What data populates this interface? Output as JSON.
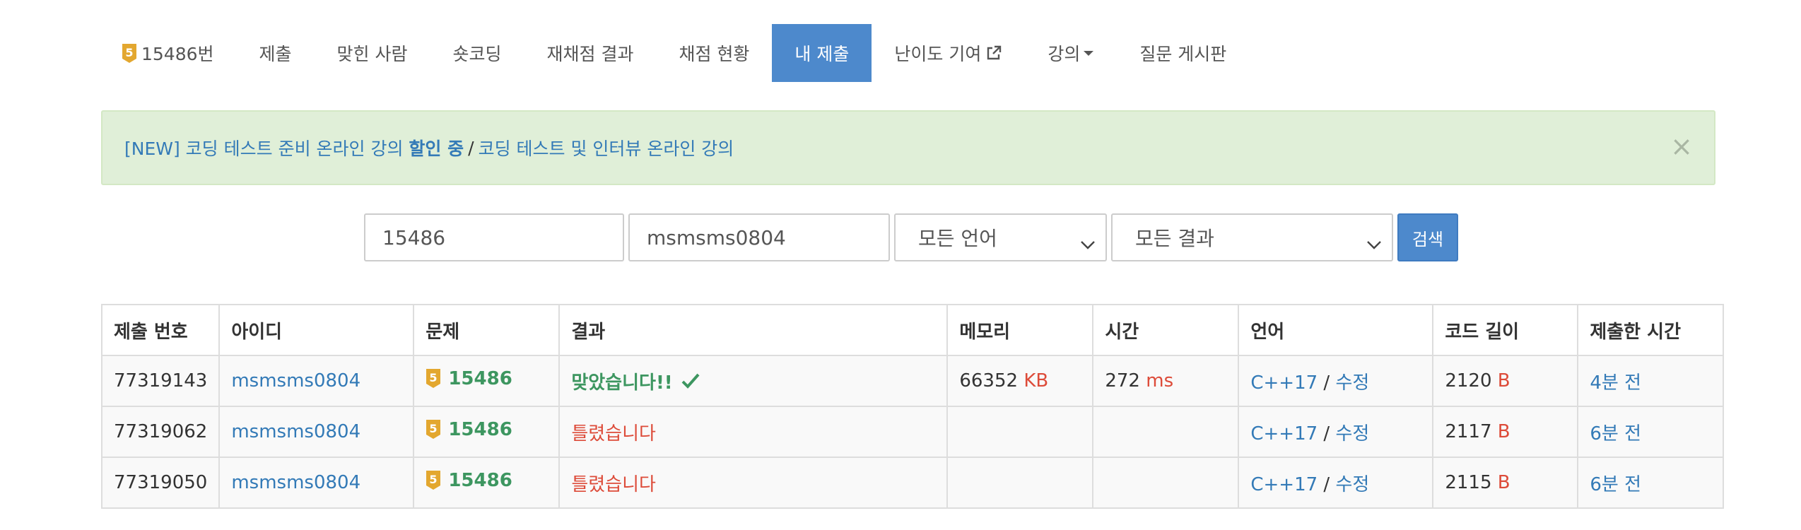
{
  "nav": {
    "problem_tier": "5",
    "problem_label": "15486번",
    "items": [
      "제출",
      "맞힌 사람",
      "숏코딩",
      "재채점 결과",
      "채점 현황",
      "내 제출",
      "난이도 기여",
      "강의",
      "질문 게시판"
    ],
    "active_index": 5
  },
  "alert": {
    "prefix": "[NEW] 코딩 테스트 준비 온라인 강의 ",
    "bold": "할인 중",
    "separator": "/",
    "second_link": "코딩 테스트 및 인터뷰 온라인 강의",
    "close": "×"
  },
  "search": {
    "problem_id": "15486",
    "user_id": "msmsms0804",
    "language": "모든 언어",
    "result": "모든 결과",
    "button": "검색"
  },
  "table": {
    "headers": [
      "제출 번호",
      "아이디",
      "문제",
      "결과",
      "메모리",
      "시간",
      "언어",
      "코드 길이",
      "제출한 시간"
    ],
    "rows": [
      {
        "id": "77319143",
        "user": "msmsms0804",
        "tier": "5",
        "problem": "15486",
        "result": "맞았습니다!!",
        "status": "ac",
        "memory": "66352",
        "memory_unit": "KB",
        "time": "272",
        "time_unit": "ms",
        "language": "C++17",
        "sep": "/",
        "edit": "수정",
        "length": "2120",
        "length_unit": "B",
        "submitted": "4분 전"
      },
      {
        "id": "77319062",
        "user": "msmsms0804",
        "tier": "5",
        "problem": "15486",
        "result": "틀렸습니다",
        "status": "wa",
        "memory": "",
        "memory_unit": "",
        "time": "",
        "time_unit": "",
        "language": "C++17",
        "sep": "/",
        "edit": "수정",
        "length": "2117",
        "length_unit": "B",
        "submitted": "6분 전"
      },
      {
        "id": "77319050",
        "user": "msmsms0804",
        "tier": "5",
        "problem": "15486",
        "result": "틀렸습니다",
        "status": "wa",
        "memory": "",
        "memory_unit": "",
        "time": "",
        "time_unit": "",
        "language": "C++17",
        "sep": "/",
        "edit": "수정",
        "length": "2115",
        "length_unit": "B",
        "submitted": "6분 전"
      }
    ]
  },
  "colors": {
    "primary": "#4d89cc",
    "link": "#337ab7",
    "success": "#3d9660",
    "danger": "#dd4b39",
    "alert_bg": "#e0efd8",
    "tier_silver": "#e3a72f"
  },
  "icons": [
    "tier-badge-icon",
    "external-link-icon",
    "caret-down-icon",
    "close-icon",
    "chevron-down-icon",
    "check-icon"
  ]
}
